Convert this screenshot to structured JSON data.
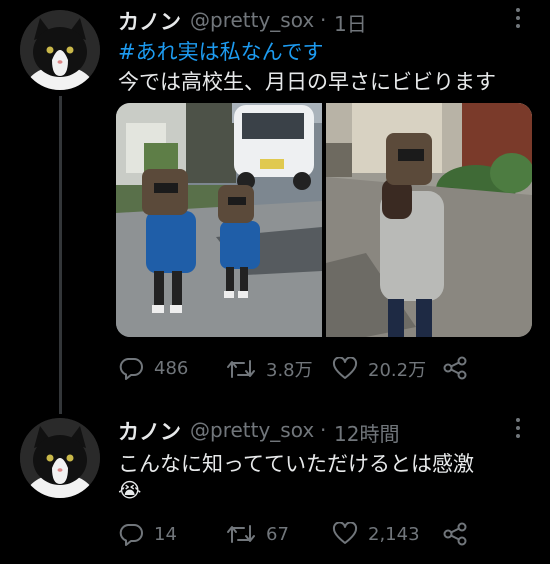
{
  "tweet1": {
    "display_name": "カノン",
    "handle": "@pretty_sox",
    "separator": "·",
    "time": "1日",
    "hashtag": "#あれ実は私なんです",
    "text": "今では高校生、月日の早さにビビります",
    "stats": {
      "replies": "486",
      "retweets": "3.8万",
      "likes": "20.2万"
    },
    "media": [
      {
        "icon": "photo-children-welding-masks"
      },
      {
        "icon": "photo-teen-welding-mask"
      }
    ]
  },
  "tweet2": {
    "display_name": "カノン",
    "handle": "@pretty_sox",
    "separator": "·",
    "time": "12時間",
    "text": "こんなに知ってていただけるとは感激",
    "emoji": "😭",
    "stats": {
      "replies": "14",
      "retweets": "67",
      "likes": "2,143"
    }
  },
  "colors": {
    "background": "#000000",
    "text": "#e7e9ea",
    "secondary": "#71767b",
    "link": "#1d9bf0"
  }
}
